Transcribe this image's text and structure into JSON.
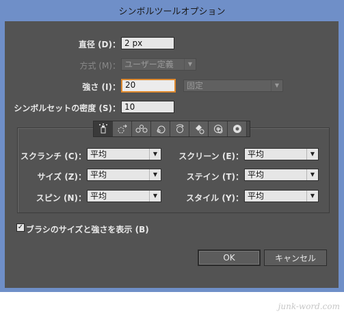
{
  "window": {
    "title": "シンボルツールオプション"
  },
  "diameter": {
    "label": "直径 (D)：",
    "value": "2 px"
  },
  "method": {
    "label": "方式 (M)：",
    "value": "ユーザー定義"
  },
  "intensity": {
    "label": "強さ (I)：",
    "value": "20",
    "pressure_value": "固定"
  },
  "density": {
    "label": "シンボルセットの密度 (S)：",
    "value": "10"
  },
  "tools": [
    {
      "name": "symbol-sprayer"
    },
    {
      "name": "symbol-shifter"
    },
    {
      "name": "symbol-scruncher"
    },
    {
      "name": "symbol-sizer"
    },
    {
      "name": "symbol-spinner"
    },
    {
      "name": "symbol-stainer"
    },
    {
      "name": "symbol-screener"
    },
    {
      "name": "symbol-styler"
    }
  ],
  "options": {
    "scrunch": {
      "label": "スクランチ (C)：",
      "value": "平均"
    },
    "size": {
      "label": "サイズ (Z)：",
      "value": "平均"
    },
    "spin": {
      "label": "スピン (N)：",
      "value": "平均"
    },
    "screen": {
      "label": "スクリーン (E)：",
      "value": "平均"
    },
    "stain": {
      "label": "ステイン (T)：",
      "value": "平均"
    },
    "style": {
      "label": "スタイル (Y)：",
      "value": "平均"
    }
  },
  "show_brush": {
    "label": "ブラシのサイズと強さを表示 (B)",
    "checked": true,
    "mark": "✓"
  },
  "buttons": {
    "ok": "OK",
    "cancel": "キャンセル"
  },
  "watermark": "junk-word.com"
}
